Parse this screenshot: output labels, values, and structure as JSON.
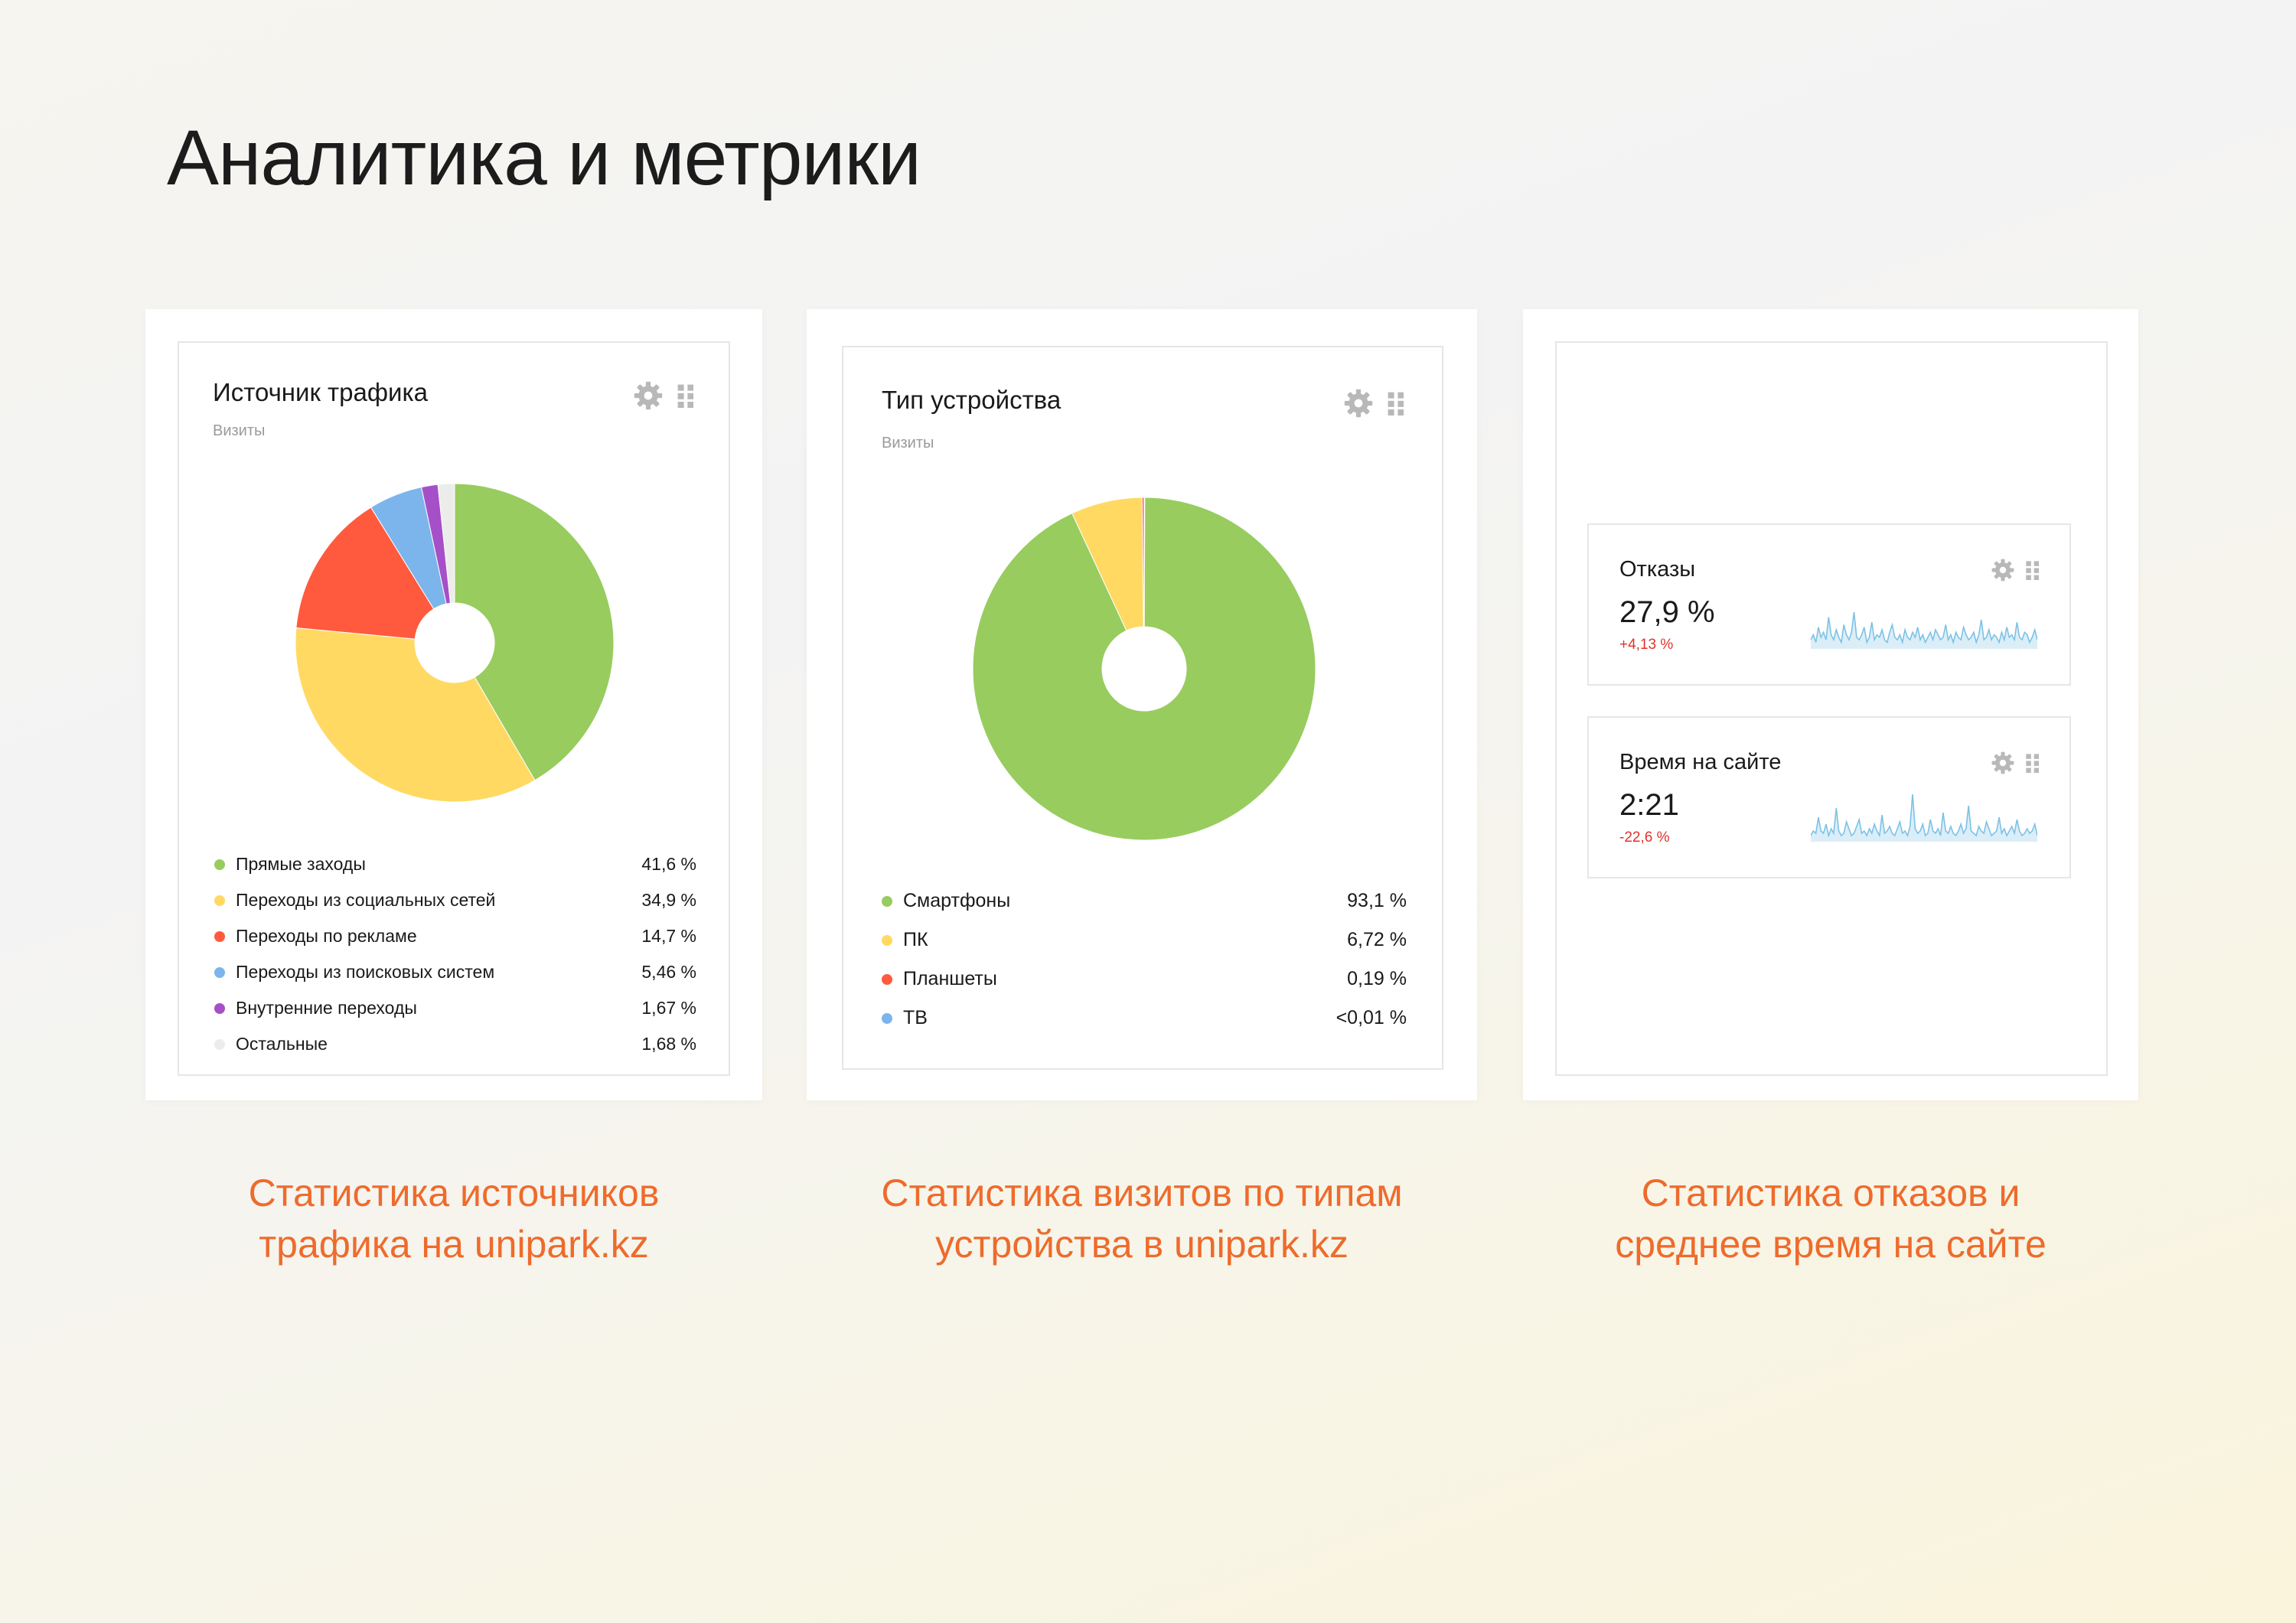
{
  "page": {
    "title": "Аналитика и метрики"
  },
  "colors": {
    "green": "#98cc5f",
    "yellow": "#ffd962",
    "red": "#ff5a3d",
    "blue": "#7cb5ec",
    "purple": "#a550c8",
    "light": "#ececea",
    "accent": "#ee6b2c",
    "negative": "#e0322d",
    "spark": "#7cc2e6"
  },
  "icons": {
    "settings": "gear-icon",
    "drag": "drag-handle-icon"
  },
  "traffic_card": {
    "title": "Источник трафика",
    "subtitle": "Визиты",
    "caption": "Статистика источников трафика на unipark.kz"
  },
  "device_card": {
    "title": "Тип устройства",
    "subtitle": "Визиты",
    "caption": "Статистика визитов по типам устройства в unipark.kz"
  },
  "metrics_panel": {
    "caption": "Статистика отказов и среднее время на сайте",
    "bounce": {
      "title": "Отказы",
      "value": "27,9 %",
      "delta": "+4,13 %"
    },
    "time": {
      "title": "Время на сайте",
      "value": "2:21",
      "delta": "-22,6 %"
    }
  },
  "chart_data": [
    {
      "type": "pie",
      "title": "Источник трафика",
      "subtitle": "Визиты",
      "slices": [
        {
          "label": "Прямые заходы",
          "value": 41.6,
          "display": "41,6 %",
          "color": "#98cc5f"
        },
        {
          "label": "Переходы из социальных сетей",
          "value": 34.9,
          "display": "34,9 %",
          "color": "#ffd962"
        },
        {
          "label": "Переходы по рекламе",
          "value": 14.7,
          "display": "14,7 %",
          "color": "#ff5a3d"
        },
        {
          "label": "Переходы из поисковых систем",
          "value": 5.46,
          "display": "5,46 %",
          "color": "#7cb5ec"
        },
        {
          "label": "Внутренние переходы",
          "value": 1.67,
          "display": "1,67 %",
          "color": "#a550c8"
        },
        {
          "label": "Остальные",
          "value": 1.68,
          "display": "1,68 %",
          "color": "#ececea"
        }
      ],
      "legend_position": "bottom"
    },
    {
      "type": "pie",
      "title": "Тип устройства",
      "subtitle": "Визиты",
      "slices": [
        {
          "label": "Смартфоны",
          "value": 93.1,
          "display": "93,1 %",
          "color": "#98cc5f"
        },
        {
          "label": "ПК",
          "value": 6.72,
          "display": "6,72 %",
          "color": "#ffd962"
        },
        {
          "label": "Планшеты",
          "value": 0.19,
          "display": "0,19 %",
          "color": "#ff5a3d"
        },
        {
          "label": "ТВ",
          "value": 0.005,
          "display": "<0,01 %",
          "color": "#7cb5ec"
        }
      ],
      "legend_position": "bottom"
    },
    {
      "type": "line",
      "title": "Отказы",
      "series": [
        {
          "values": [
            3,
            5,
            2,
            8,
            4,
            6,
            3,
            12,
            5,
            3,
            7,
            4,
            2,
            9,
            5,
            3,
            6,
            14,
            4,
            3,
            5,
            8,
            2,
            4,
            10,
            3,
            5,
            4,
            7,
            3,
            2,
            6,
            9,
            4,
            3,
            5,
            2,
            7,
            4,
            3,
            6,
            4,
            8,
            3,
            5,
            2,
            4,
            6,
            3,
            7,
            5,
            3,
            4,
            9,
            3,
            5,
            2,
            6,
            4,
            3,
            8,
            5,
            3,
            4,
            6,
            2,
            5,
            11,
            3,
            4,
            7,
            3,
            5,
            4,
            2,
            6,
            3,
            8,
            4,
            5,
            3,
            10,
            4,
            3,
            6,
            5,
            2,
            4,
            7,
            3
          ]
        }
      ]
    },
    {
      "type": "line",
      "title": "Время на сайте",
      "series": [
        {
          "values": [
            2,
            4,
            3,
            10,
            4,
            3,
            7,
            2,
            5,
            3,
            14,
            4,
            2,
            3,
            8,
            5,
            2,
            3,
            6,
            9,
            3,
            4,
            2,
            5,
            3,
            7,
            4,
            2,
            11,
            3,
            4,
            6,
            3,
            2,
            5,
            8,
            3,
            4,
            2,
            6,
            20,
            5,
            3,
            4,
            7,
            2,
            3,
            9,
            4,
            3,
            5,
            2,
            12,
            4,
            3,
            6,
            3,
            2,
            4,
            7,
            3,
            5,
            15,
            4,
            3,
            2,
            6,
            4,
            3,
            8,
            5,
            2,
            3,
            4,
            10,
            3,
            5,
            2,
            4,
            6,
            3,
            9,
            4,
            2,
            3,
            5,
            3,
            4,
            7,
            2
          ]
        }
      ]
    }
  ]
}
